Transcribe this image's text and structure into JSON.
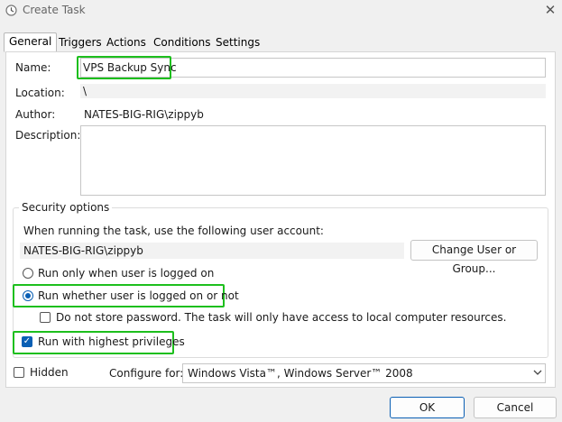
{
  "window": {
    "title": "Create Task"
  },
  "tabs": [
    "General",
    "Triggers",
    "Actions",
    "Conditions",
    "Settings"
  ],
  "general": {
    "name_label": "Name:",
    "name_value": "VPS Backup Sync",
    "location_label": "Location:",
    "location_value": "\\",
    "author_label": "Author:",
    "author_value": "NATES-BIG-RIG\\zippyb",
    "description_label": "Description:",
    "description_value": ""
  },
  "security": {
    "title": "Security options",
    "account_prompt": "When running the task, use the following user account:",
    "account_value": "NATES-BIG-RIG\\zippyb",
    "change_button": "Change User or Group...",
    "radio_logged_on": "Run only when user is logged on",
    "radio_whether": "Run whether user is logged on or not",
    "no_store_password": "Do not store password.  The task will only have access to local computer resources.",
    "highest_privileges": "Run with highest privileges"
  },
  "bottom": {
    "hidden_label": "Hidden",
    "configure_label": "Configure for:",
    "configure_value": "Windows Vista™, Windows Server™ 2008"
  },
  "buttons": {
    "ok": "OK",
    "cancel": "Cancel"
  },
  "state": {
    "selected_tab": "General",
    "run_whether_selected": true,
    "do_not_store_password": false,
    "highest_privileges_checked": true,
    "hidden_checked": false
  },
  "colors": {
    "highlight": "#1dbf1d",
    "accent": "#0a5fb4"
  },
  "icons": {
    "title": "clock-icon",
    "close": "close-icon",
    "dropdown": "chevron-down-icon"
  }
}
